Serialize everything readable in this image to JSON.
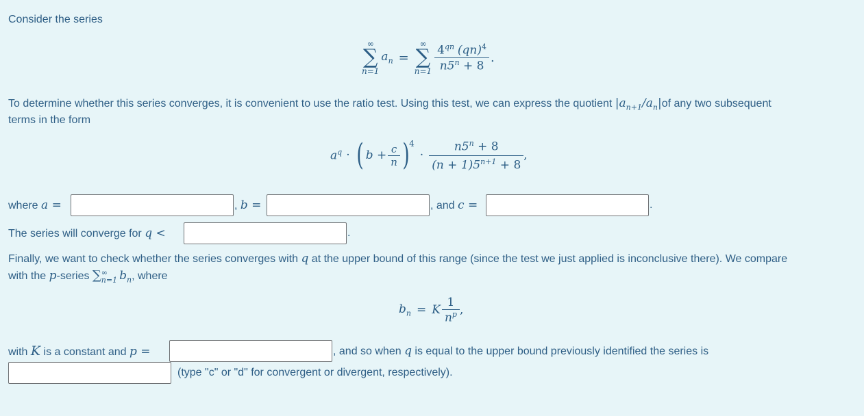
{
  "intro": {
    "text": "Consider the series"
  },
  "series_eq": {
    "sigma": "∑",
    "upper": "∞",
    "lower": "n=1",
    "term": "a",
    "term_sub": "n",
    "equals": "=",
    "num_base": "4",
    "num_exp": "qn",
    "num_rest": "(qn)",
    "num_rest_exp": "4",
    "den_main": "n5",
    "den_exp": "n",
    "den_rest": " + 8",
    "end": "."
  },
  "para2": {
    "line1_a": "To determine whether this series converges, it is convenient to use the ratio test. Using this test, we can express the quotient ",
    "quotient": "|a",
    "quotient_sub1": "n+1",
    "quotient_mid": "/a",
    "quotient_sub2": "n",
    "quotient_end": "|",
    "line1_b": "of any two subsequent",
    "line2": "terms in the form"
  },
  "ratio_form": {
    "a": "a",
    "a_exp": "q",
    "dot": "·",
    "lparen": "(",
    "b_plus": "b +",
    "c": "c",
    "n": "n",
    "rparen": ")",
    "paren_exp": "4",
    "num": "n5",
    "num_exp": "n",
    "num_rest": " + 8",
    "den": "(n + 1)5",
    "den_exp": "n+1",
    "den_rest": " + 8",
    "end": ","
  },
  "row_abc": {
    "where": "where ",
    "a_var": "a",
    "eq": " =",
    "comma_b": ", ",
    "b_var": "b",
    "and_c": ", and ",
    "c_var": "c",
    "period": ".",
    "a_value": "",
    "b_value": "",
    "c_value": ""
  },
  "row_q": {
    "text": "The series will converge for ",
    "q_var": "q",
    "lt": " <",
    "q_value": "",
    "period": "."
  },
  "para3": {
    "line1_a": "Finally, we want to check whether the series converges with ",
    "q_var": "q",
    "line1_b": " at the upper bound of this range (since the test we just applied is inconclusive there). We compare",
    "line2_a": "with the ",
    "p_var": "p",
    "line2_b": "-series ",
    "sum_sigma": "∑",
    "sum_upper": "∞",
    "sum_lower": "n=1",
    "b": "b",
    "b_sub": "n",
    "line2_c": ", where"
  },
  "bn_eq": {
    "b": "b",
    "b_sub": "n",
    "eq": "=",
    "K": "K",
    "num": "1",
    "den": "n",
    "den_exp": "p",
    "end": ","
  },
  "row_p": {
    "with": "with ",
    "K_var": "K",
    "text_a": " is a constant and ",
    "p_var": "p",
    "eq": " =",
    "text_b": ", and so when ",
    "q_var": "q",
    "text_c": " is equal to the upper bound previously identified the series is",
    "p_value": "",
    "cd_value": "",
    "hint": "(type \"c\" or \"d\" for convergent or divergent, respectively)."
  }
}
